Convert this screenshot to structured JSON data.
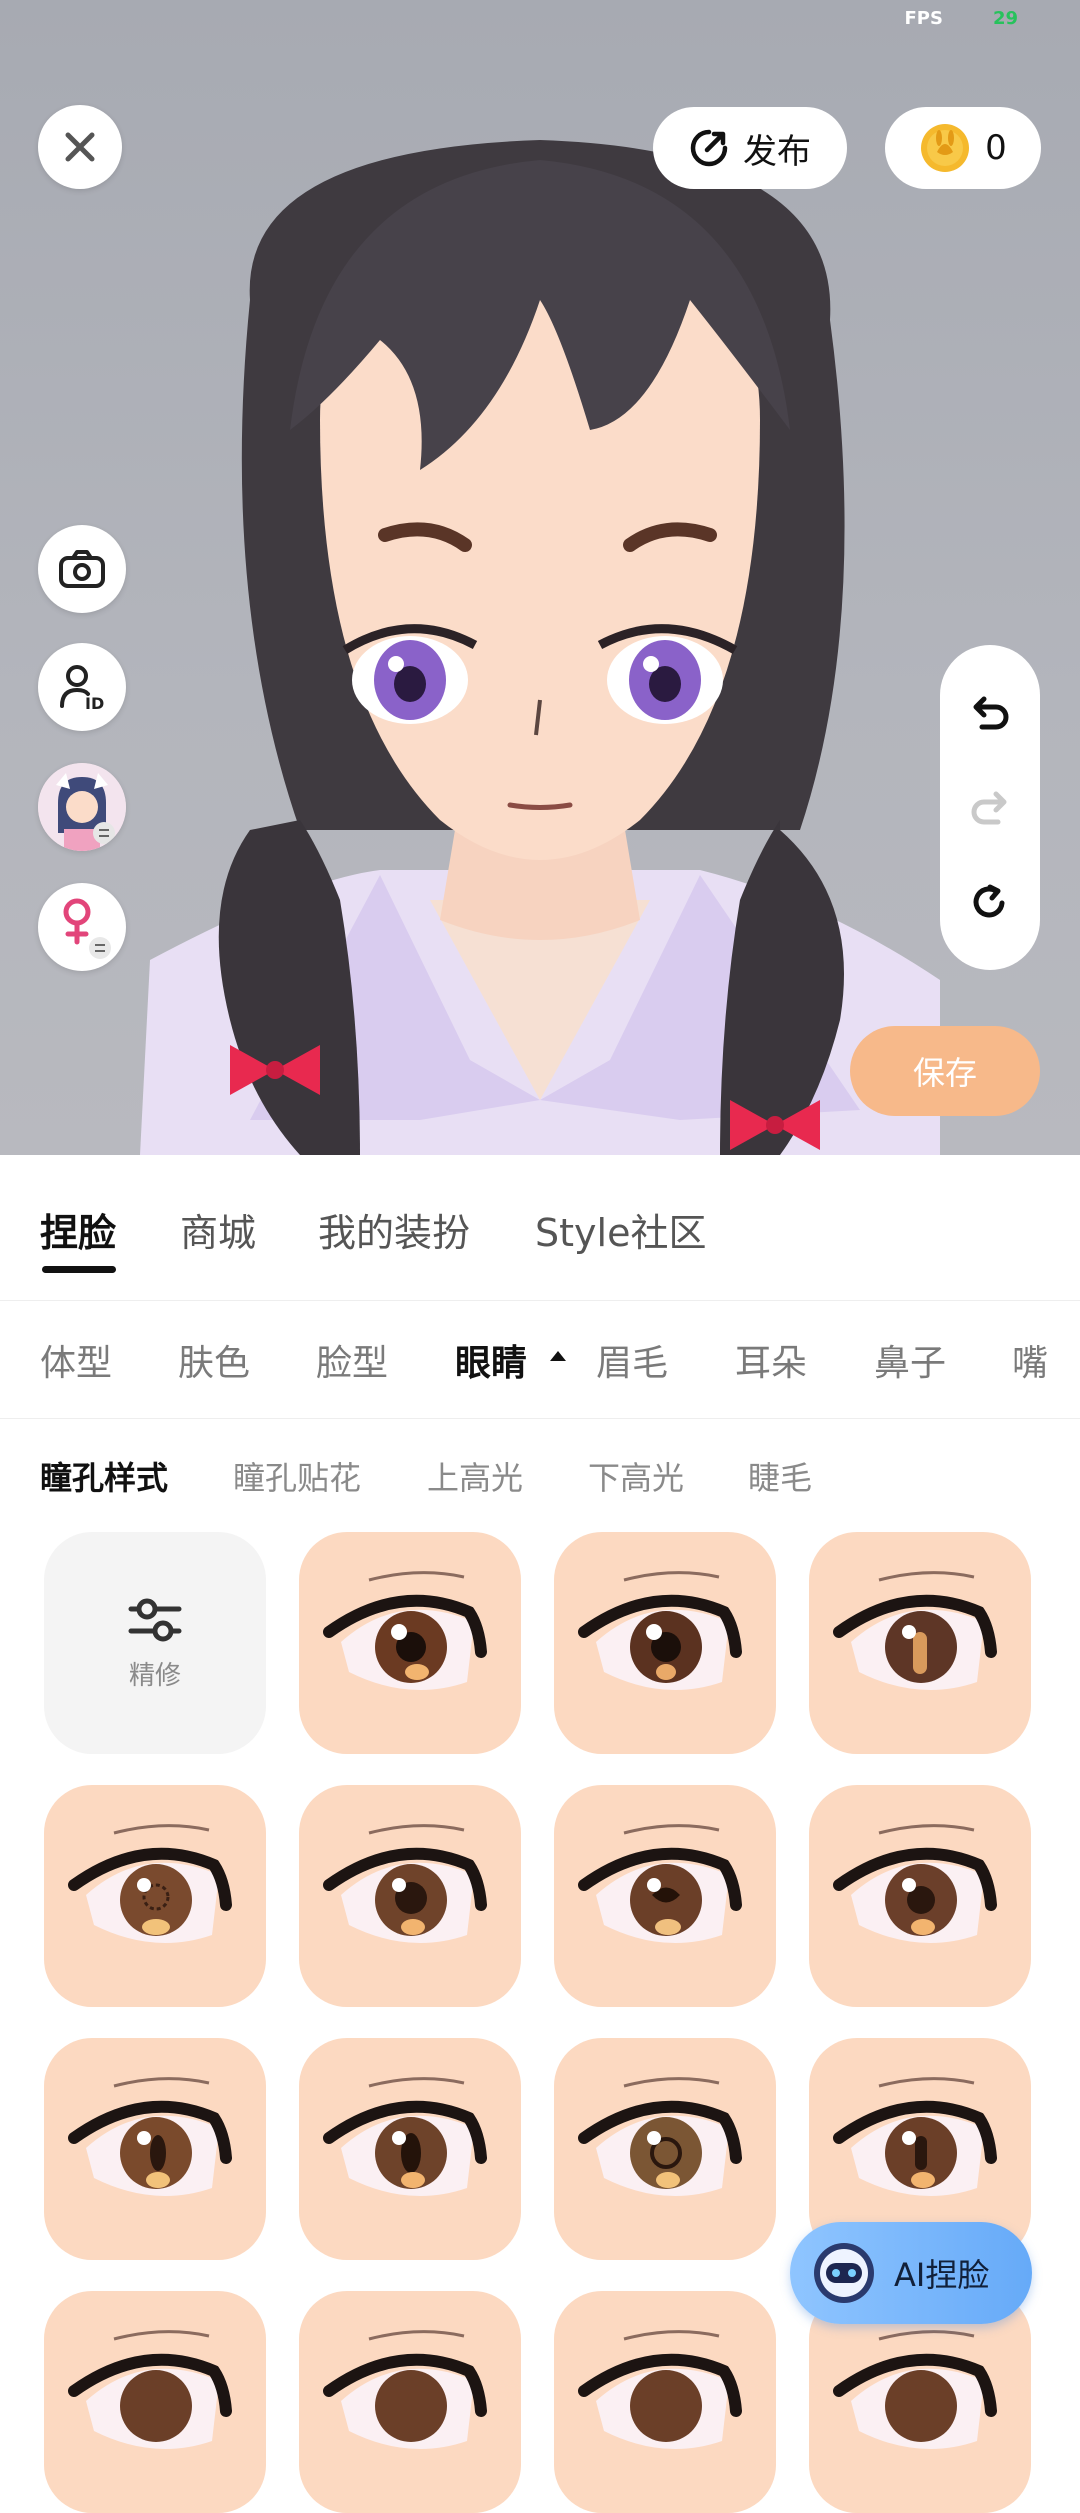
{
  "viewport": {
    "fps_label": "FPS",
    "fps_value": "29",
    "publish_label": "发布",
    "coins_value": "0",
    "save_label": "保存"
  },
  "tabs_main": [
    {
      "label": "捏脸",
      "active": true
    },
    {
      "label": "商城",
      "active": false
    },
    {
      "label": "我的装扮",
      "active": false
    },
    {
      "label": "Style社区",
      "active": false
    }
  ],
  "tabs_category": [
    {
      "label": "体型",
      "active": false
    },
    {
      "label": "肤色",
      "active": false
    },
    {
      "label": "脸型",
      "active": false
    },
    {
      "label": "眼睛",
      "active": true
    },
    {
      "label": "眉毛",
      "active": false
    },
    {
      "label": "耳朵",
      "active": false
    },
    {
      "label": "鼻子",
      "active": false
    },
    {
      "label": "嘴",
      "active": false
    }
  ],
  "tabs_sub": [
    {
      "label": "瞳孔样式",
      "active": true
    },
    {
      "label": "瞳孔贴花",
      "active": false
    },
    {
      "label": "上高光",
      "active": false
    },
    {
      "label": "下高光",
      "active": false
    },
    {
      "label": "睫毛",
      "active": false
    }
  ],
  "refine_label": "精修",
  "ai_face_label": "AI捏脸",
  "colors": {
    "accent_save": "#f7b98a",
    "tile_bg": "#fcd9c1",
    "ai_button": "#66aaf8",
    "fps_value": "#27c25c"
  }
}
